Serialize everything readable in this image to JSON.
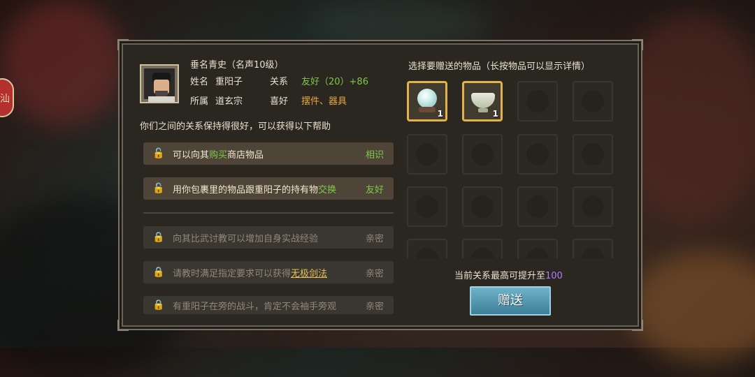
{
  "side_button": {
    "label": "汕"
  },
  "header": {
    "title": "垂名青史（名声10级）",
    "name_label": "姓名",
    "name_value": "重阳子",
    "relation_label": "关系",
    "relation_value": "友好（20）+86",
    "faction_label": "所属",
    "faction_value": "道玄宗",
    "likes_label": "喜好",
    "likes_value": "摆件、器具"
  },
  "help_intro": "你们之间的关系保持得很好，可以获得以下帮助",
  "benefits": [
    {
      "pre": "可以向其",
      "highlight": "购买",
      "post": "商店物品",
      "tag": "相识",
      "unlocked": true
    },
    {
      "pre": "用你包裹里的物品跟重阳子的持有物",
      "highlight": "交换",
      "post": "",
      "tag": "友好",
      "unlocked": true
    },
    {
      "pre": "向其比武讨教可以增加自身实战经验",
      "highlight": "",
      "post": "",
      "tag": "亲密",
      "unlocked": false
    },
    {
      "pre": "请教时满足指定要求可以获得",
      "highlight": "无极剑法",
      "post": "",
      "tag": "亲密",
      "unlocked": false
    },
    {
      "pre": "有重阳子在旁的战斗，肯定不会袖手旁观",
      "highlight": "",
      "post": "",
      "tag": "亲密",
      "unlocked": false
    }
  ],
  "gift_panel": {
    "title": "选择要赠送的物品（长按物品可以显示详情）",
    "items": [
      {
        "name": "pearl-orb",
        "count": "1"
      },
      {
        "name": "jade-bowl",
        "count": "1"
      }
    ],
    "max_relation_prefix": "当前关系最高可提升至",
    "max_relation_value": "100",
    "gift_button": "赠送"
  },
  "colors": {
    "accent_green": "#7fc84a",
    "accent_orange": "#e6a93a",
    "accent_purple": "#b07cff",
    "button_blue": "#4f93ad",
    "close_red": "#c8413f"
  }
}
